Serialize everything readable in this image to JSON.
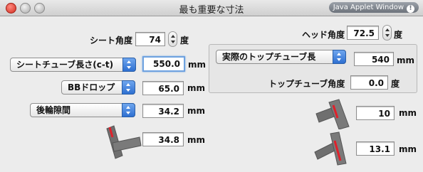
{
  "window": {
    "title": "最も重要な寸法",
    "badge": "Java Applet Window",
    "badge_icon": "warning-icon"
  },
  "seat_angle": {
    "label": "シート角度",
    "value": "74",
    "unit": "度"
  },
  "head_angle": {
    "label": "ヘッド角度",
    "value": "72.5",
    "unit": "度"
  },
  "seat_tube": {
    "selected": "シートチューブ長さ(c-t)",
    "value": "550.0",
    "unit": "mm"
  },
  "top_tube": {
    "selected": "実際のトップチューブ長",
    "value": "540",
    "unit": "mm"
  },
  "bb_drop": {
    "selected": "BBドロップ",
    "value": "65.0",
    "unit": "mm"
  },
  "top_tube_angle": {
    "label": "トップチューブ角度",
    "value": "0.0",
    "unit": "度"
  },
  "chainstay": {
    "selected": "後輪隙間",
    "value": "34.2",
    "unit": "mm"
  },
  "head_spacer": {
    "value": "10",
    "unit": "mm"
  },
  "seat_offset": {
    "value": "34.8",
    "unit": "mm"
  },
  "fork_offset": {
    "value": "13.1",
    "unit": "mm"
  },
  "colors": {
    "accent": "#2e6fd1",
    "marker": "#e0202a",
    "tube": "#707070"
  }
}
